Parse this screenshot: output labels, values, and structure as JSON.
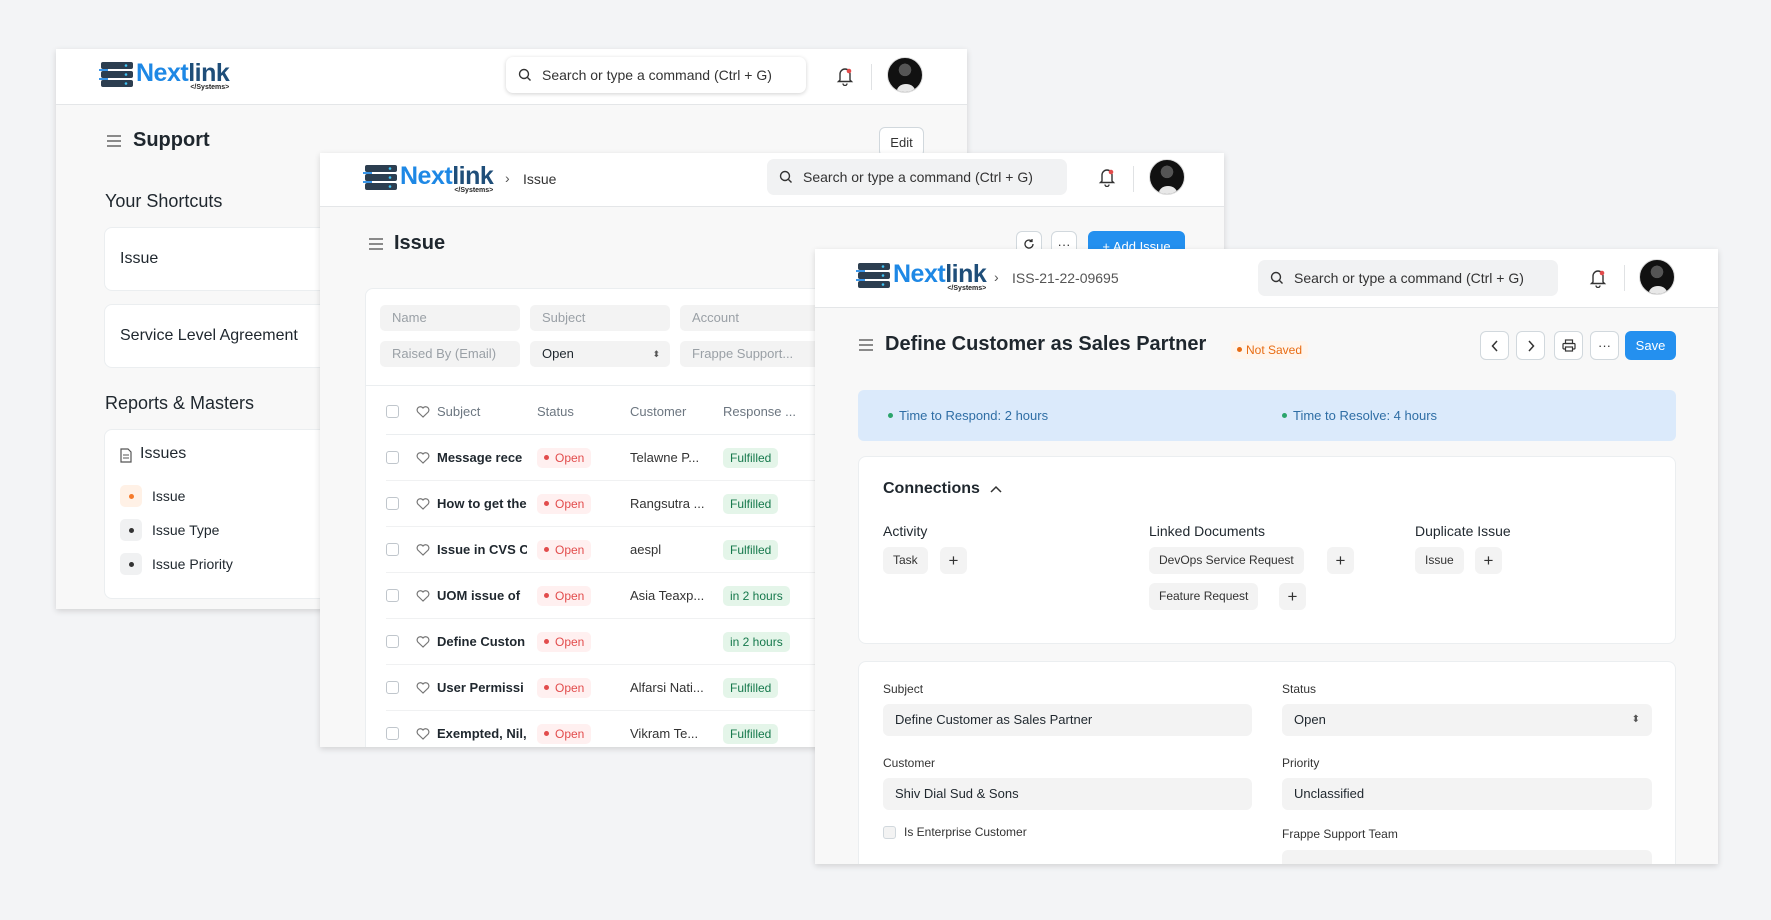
{
  "brand": {
    "name_first": "Next",
    "name_rest": "link",
    "sub": "</Systems>"
  },
  "search_placeholder": "Search or type a command (Ctrl + G)",
  "colors": {
    "primary": "#2490ef",
    "brand_blue": "#1e88e5",
    "open_red": "#e24c4c",
    "fulfilled_green": "#16794c",
    "sla_bg": "#dbeafb"
  },
  "workspace": {
    "title": "Support",
    "edit_label": "Edit",
    "shortcuts_heading": "Your Shortcuts",
    "shortcuts": [
      "Issue",
      "Service Level Agreement"
    ],
    "reports_heading": "Reports & Masters",
    "reports_card_title": "Issues",
    "reports_links": [
      "Issue",
      "Issue Type",
      "Issue Priority"
    ]
  },
  "issue_list": {
    "breadcrumb": "Issue",
    "title": "Issue",
    "add_label": "+ Add Issue",
    "filters": {
      "name": "Name",
      "subject": "Subject",
      "account": "Account",
      "raised_by": "Raised By (Email)",
      "status": "Open",
      "team": "Frappe Support..."
    },
    "columns": {
      "subject": "Subject",
      "status": "Status",
      "customer": "Customer",
      "response": "Response ..."
    },
    "rows": [
      {
        "subject": "Message rece",
        "status": "Open",
        "customer": "Telawne P...",
        "response": "Fulfilled"
      },
      {
        "subject": "How to get the",
        "status": "Open",
        "customer": "Rangsutra ...",
        "response": "Fulfilled"
      },
      {
        "subject": "Issue in CVS C",
        "status": "Open",
        "customer": "aespl",
        "response": "Fulfilled"
      },
      {
        "subject": "UOM issue of",
        "status": "Open",
        "customer": "Asia Teaxp...",
        "response": "in 2 hours"
      },
      {
        "subject": "Define Custon",
        "status": "Open",
        "customer": "",
        "response": "in 2 hours"
      },
      {
        "subject": "User Permissi",
        "status": "Open",
        "customer": "Alfarsi Nati...",
        "response": "Fulfilled"
      },
      {
        "subject": "Exempted, Nil,",
        "status": "Open",
        "customer": "Vikram Te...",
        "response": "Fulfilled"
      }
    ]
  },
  "issue_form": {
    "breadcrumb": "ISS-21-22-09695",
    "title": "Define Customer as Sales Partner",
    "not_saved": "Not Saved",
    "more_label": "···",
    "save_label": "Save",
    "sla": {
      "respond": "Time to Respond: 2 hours",
      "resolve": "Time to Resolve: 4 hours"
    },
    "connections": {
      "heading": "Connections",
      "activity": {
        "heading": "Activity",
        "items": [
          "Task"
        ]
      },
      "linked": {
        "heading": "Linked Documents",
        "items": [
          "DevOps Service Request",
          "Feature Request"
        ]
      },
      "duplicate": {
        "heading": "Duplicate Issue",
        "items": [
          "Issue"
        ]
      }
    },
    "fields": {
      "subject_label": "Subject",
      "subject_value": "Define Customer as Sales Partner",
      "status_label": "Status",
      "status_value": "Open",
      "customer_label": "Customer",
      "customer_value": "Shiv Dial Sud & Sons",
      "priority_label": "Priority",
      "priority_value": "Unclassified",
      "enterprise_label": "Is Enterprise Customer",
      "team_label": "Frappe Support Team"
    }
  }
}
